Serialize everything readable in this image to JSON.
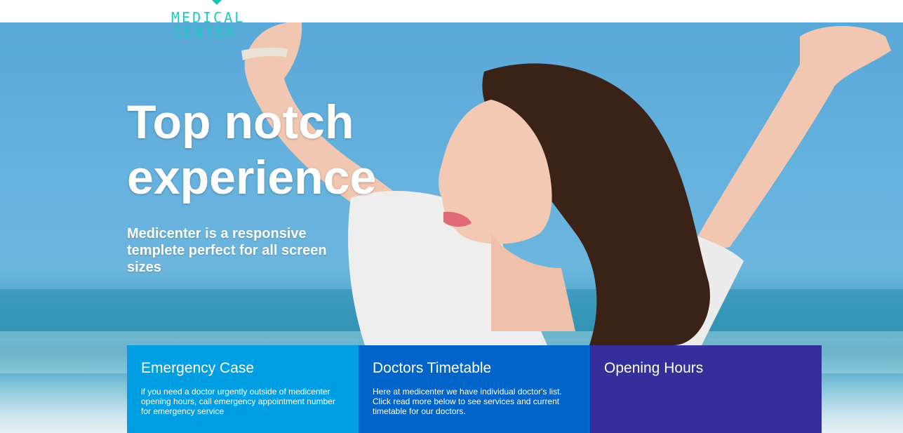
{
  "logo": {
    "line1": "MEDICAL",
    "line2": "CENTER"
  },
  "hero": {
    "title": "Top notch experience",
    "subtitle": "Medicenter is a responsive templete perfect for all screen sizes"
  },
  "boxes": [
    {
      "title": "Emergency Case",
      "text": "if you need a doctor urgently outside of medicenter opening hours, call emergency appointment number for emergency service"
    },
    {
      "title": "Doctors Timetable",
      "text": "Here at medicenter we have individual doctor's list. Click read more below to see services and current timetable for our doctors."
    },
    {
      "title": "Opening Hours",
      "text": ""
    }
  ],
  "colors": {
    "logo": "#1ccbc0",
    "box_emergency": "#009fe3",
    "box_timetable": "#0064c8",
    "box_hours": "#352f9c"
  }
}
